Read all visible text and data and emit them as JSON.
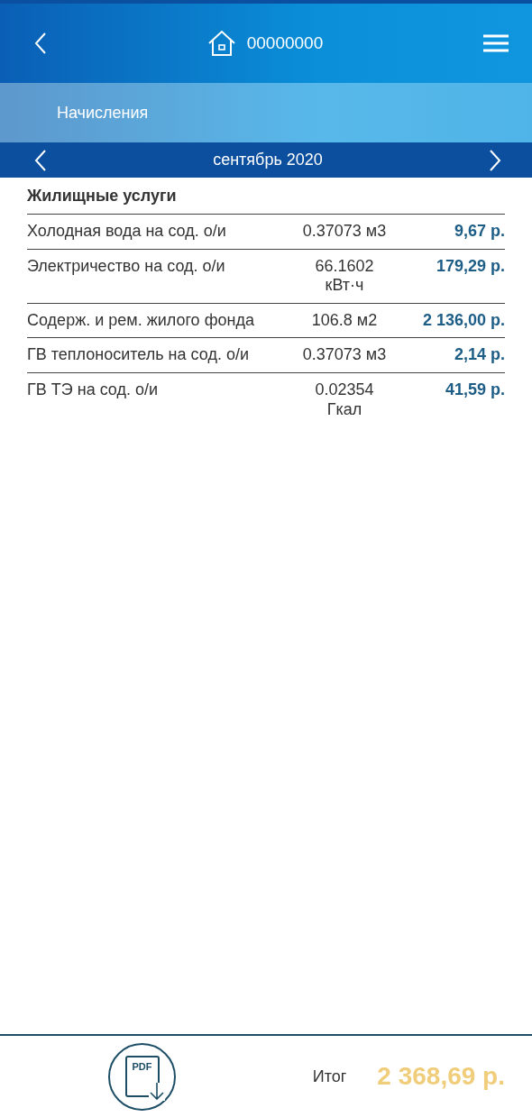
{
  "header": {
    "account": "00000000"
  },
  "section": {
    "title": "Начисления"
  },
  "period": {
    "label": "сентябрь 2020"
  },
  "group": {
    "title": "Жилищные услуги"
  },
  "rows": [
    {
      "name": "Холодная вода на сод. о/и",
      "quantity": "0.37073 м3",
      "amount": "9,67 р."
    },
    {
      "name": "Электричество на сод. о/и",
      "quantity": "66.1602 кВт·ч",
      "amount": "179,29 р."
    },
    {
      "name": "Содерж. и рем. жилого фонда",
      "quantity": "106.8 м2",
      "amount": "2 136,00 р."
    },
    {
      "name": "ГВ теплоноситель на сод. о/и",
      "quantity": "0.37073 м3",
      "amount": "2,14 р."
    },
    {
      "name": "ГВ ТЭ на сод. о/и",
      "quantity": "0.02354 Гкал",
      "amount": "41,59 р."
    }
  ],
  "footer": {
    "pdf_label": "PDF",
    "total_label": "Итог",
    "total": "2 368,69 р."
  }
}
